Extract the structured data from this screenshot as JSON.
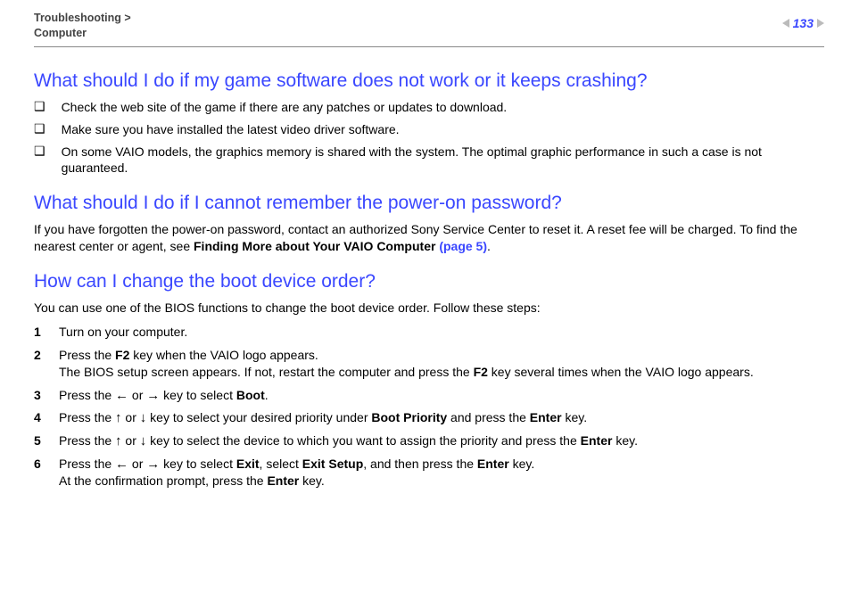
{
  "header": {
    "breadcrumb_line1": "Troubleshooting >",
    "breadcrumb_line2": "Computer",
    "page_number": "133"
  },
  "section1": {
    "title": "What should I do if my game software does not work or it keeps crashing?",
    "bullets": [
      "Check the web site of the game if there are any patches or updates to download.",
      "Make sure you have installed the latest video driver software.",
      "On some VAIO models, the graphics memory is shared with the system. The optimal graphic performance in such a case is not guaranteed."
    ]
  },
  "section2": {
    "title": "What should I do if I cannot remember the power-on password?",
    "para_a": "If you have forgotten the power-on password, contact an authorized Sony Service Center to reset it. A reset fee will be charged. To find the nearest center or agent, see ",
    "para_bold": "Finding More about Your VAIO Computer ",
    "para_link": "(page 5)",
    "para_end": "."
  },
  "section3": {
    "title": "How can I change the boot device order?",
    "intro": "You can use one of the BIOS functions to change the boot device order. Follow these steps:",
    "steps": {
      "s1": "Turn on your computer.",
      "s2a": "Press the ",
      "s2b": "F2",
      "s2c": " key when the VAIO logo appears.",
      "s2d": "The BIOS setup screen appears. If not, restart the computer and press the ",
      "s2e": "F2",
      "s2f": " key several times when the VAIO logo appears.",
      "s3a": "Press the ",
      "s3b": " or ",
      "s3c": " key to select ",
      "s3d": "Boot",
      "s3e": ".",
      "s4a": "Press the ",
      "s4b": " or ",
      "s4c": " key to select your desired priority under ",
      "s4d": "Boot Priority",
      "s4e": " and press the ",
      "s4f": "Enter",
      "s4g": " key.",
      "s5a": "Press the ",
      "s5b": " or ",
      "s5c": " key to select the device to which you want to assign the priority and press the ",
      "s5d": "Enter",
      "s5e": " key.",
      "s6a": "Press the ",
      "s6b": " or ",
      "s6c": " key to select ",
      "s6d": "Exit",
      "s6e": ", select ",
      "s6f": "Exit Setup",
      "s6g": ", and then press the ",
      "s6h": "Enter",
      "s6i": " key.",
      "s6j": "At the confirmation prompt, press the ",
      "s6k": "Enter",
      "s6l": " key."
    }
  },
  "glyphs": {
    "square": "❑",
    "left": "←",
    "right": "→",
    "up": "↑",
    "down": "↓"
  }
}
